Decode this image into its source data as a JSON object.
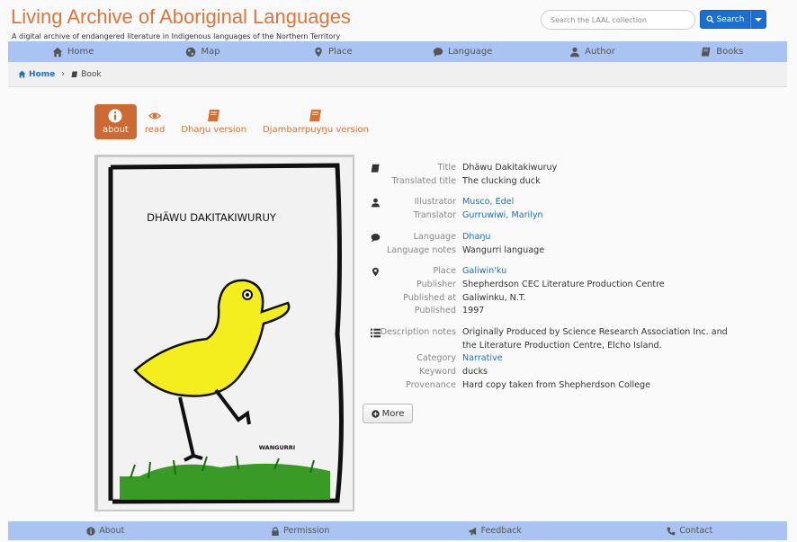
{
  "site": {
    "title": "Living Archive of Aboriginal Languages",
    "subtitle": "A digital archive of endangered literature in Indigenous languages of the Northern Territory"
  },
  "search": {
    "placeholder": "Search the LAAL collection",
    "button_label": "Search"
  },
  "nav": [
    {
      "label": "Home",
      "icon": "home-icon"
    },
    {
      "label": "Map",
      "icon": "globe-icon"
    },
    {
      "label": "Place",
      "icon": "map-marker-icon"
    },
    {
      "label": "Language",
      "icon": "speech-bubble-icon"
    },
    {
      "label": "Author",
      "icon": "user-icon"
    },
    {
      "label": "Books",
      "icon": "book-icon"
    }
  ],
  "breadcrumb": {
    "home": "Home",
    "current": "Book"
  },
  "tabs": [
    {
      "label": "about",
      "icon": "info-icon",
      "active": true
    },
    {
      "label": "read",
      "icon": "eye-icon",
      "active": false
    },
    {
      "label": "Dhaŋu version",
      "icon": "book-icon",
      "active": false
    },
    {
      "label": "Djambarrpuyŋu version",
      "icon": "book-icon",
      "active": false
    }
  ],
  "cover": {
    "title": "DHÄWU DAKITAKIWURUY",
    "footer_text": "WANGURRI"
  },
  "details": {
    "title_label": "Title",
    "title": "Dhäwu Dakitakiwuruy",
    "translated_title_label": "Translated title",
    "translated_title": "The clucking duck",
    "illustrator_label": "Illustrator",
    "illustrator": "Musco, Edel",
    "translator_label": "Translator",
    "translator": "Gurruwiwi, Marilyn",
    "language_label": "Language",
    "language": "Dhaŋu",
    "language_notes_label": "Language notes",
    "language_notes": "Wangurri language",
    "place_label": "Place",
    "place": "Galiwin'ku",
    "publisher_label": "Publisher",
    "publisher": "Shepherdson CEC Literature Production Centre",
    "published_at_label": "Published at",
    "published_at": "Galiwinku, N.T.",
    "published_label": "Published",
    "published": "1997",
    "description_label": "Description notes",
    "description": "Originally Produced by Science Research Association Inc. and the Literature Production Centre, Elcho Island.",
    "category_label": "Category",
    "category": "Narrative",
    "keyword_label": "Keyword",
    "keyword": "ducks",
    "provenance_label": "Provenance",
    "provenance": "Hard copy taken from Shepherdson College"
  },
  "more_label": "More",
  "footer": [
    {
      "label": "About",
      "icon": "info-icon"
    },
    {
      "label": "Permission",
      "icon": "lock-icon"
    },
    {
      "label": "Feedback",
      "icon": "bullhorn-icon"
    },
    {
      "label": "Contact",
      "icon": "phone-icon"
    }
  ],
  "colors": {
    "accent": "#e2743a",
    "link": "#1a6fd0",
    "nav_bg": "#a9c4f2"
  }
}
